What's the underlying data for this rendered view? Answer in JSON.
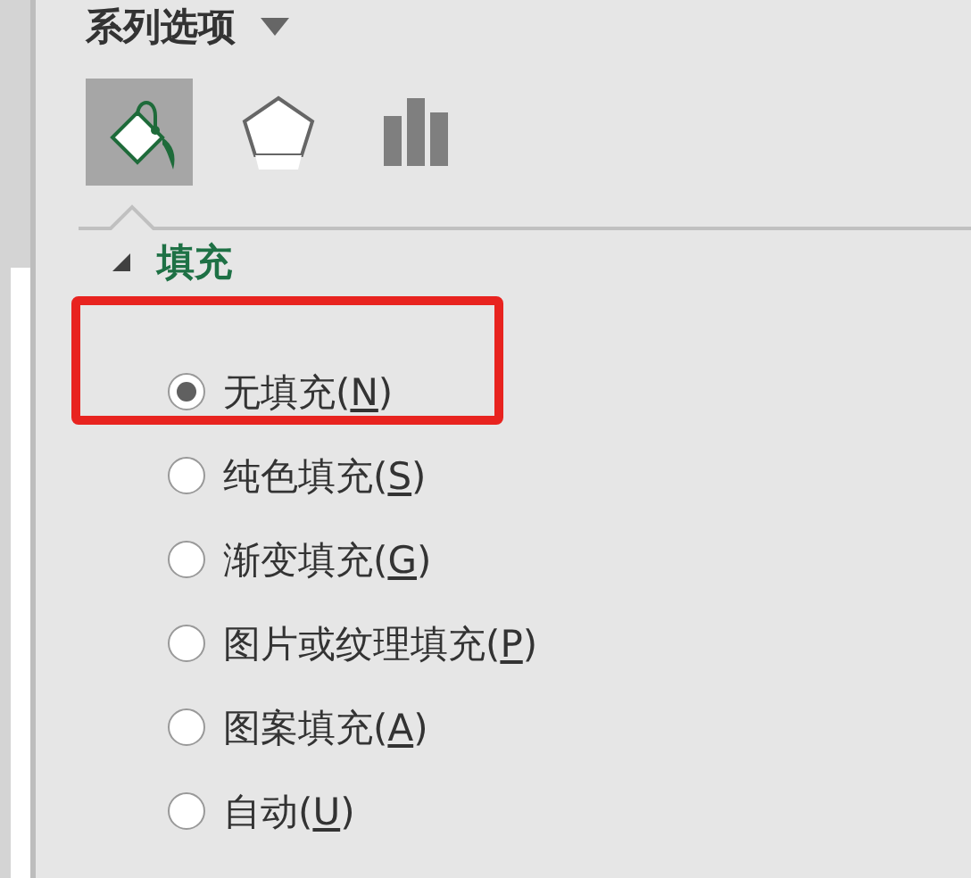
{
  "pane": {
    "title": "系列选项",
    "tabs": [
      {
        "kind": "fill",
        "selected": true
      },
      {
        "kind": "border",
        "selected": false
      },
      {
        "kind": "series",
        "selected": false
      }
    ],
    "section": {
      "title": "填充",
      "expanded": true,
      "options": [
        {
          "text": "无填充(",
          "access_key": "N",
          "suffix": ")",
          "selected": true,
          "highlighted": true
        },
        {
          "text": "纯色填充(",
          "access_key": "S",
          "suffix": ")",
          "selected": false,
          "highlighted": false
        },
        {
          "text": "渐变填充(",
          "access_key": "G",
          "suffix": ")",
          "selected": false,
          "highlighted": false
        },
        {
          "text": "图片或纹理填充(",
          "access_key": "P",
          "suffix": ")",
          "selected": false,
          "highlighted": false
        },
        {
          "text": "图案填充(",
          "access_key": "A",
          "suffix": ")",
          "selected": false,
          "highlighted": false
        },
        {
          "text": "自动(",
          "access_key": "U",
          "suffix": ")",
          "selected": false,
          "highlighted": false
        }
      ]
    }
  }
}
